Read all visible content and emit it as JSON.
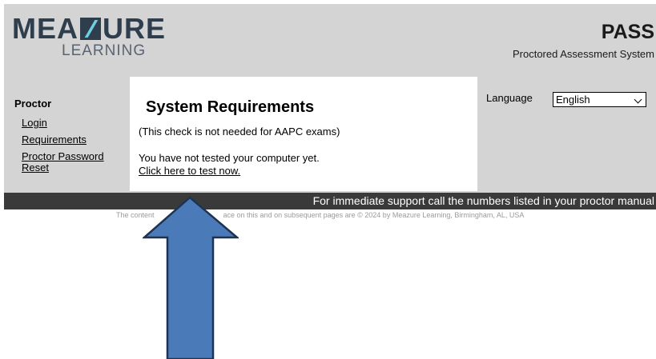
{
  "logo": {
    "top_left": "MEA",
    "top_right": "URE",
    "bottom": "LEARNING"
  },
  "header": {
    "product_name": "PASS",
    "product_subtitle": "Proctored Assessment System"
  },
  "sidebar": {
    "title": "Proctor",
    "links": [
      {
        "label": "Login"
      },
      {
        "label": "Requirements"
      },
      {
        "label": "Proctor Password Reset"
      }
    ]
  },
  "main": {
    "title": "System Requirements",
    "note": "(This check is not needed for AAPC exams)",
    "status": "You have not tested your computer yet.",
    "test_link": "Click here to test now."
  },
  "language": {
    "label": "Language",
    "selected": "English"
  },
  "support": {
    "text": "For immediate support call the numbers listed in your proctor manual"
  },
  "footer": {
    "copyright_left": "The content",
    "copyright_right": "ace on this and on subsequent pages are © 2024 by Meazure Learning, Birmingham, AL, USA"
  },
  "colors": {
    "header_bg": "#d4d4d4",
    "support_bar": "#3a3a3a",
    "arrow_fill": "#4a7ab8",
    "arrow_stroke": "#1f3350"
  }
}
